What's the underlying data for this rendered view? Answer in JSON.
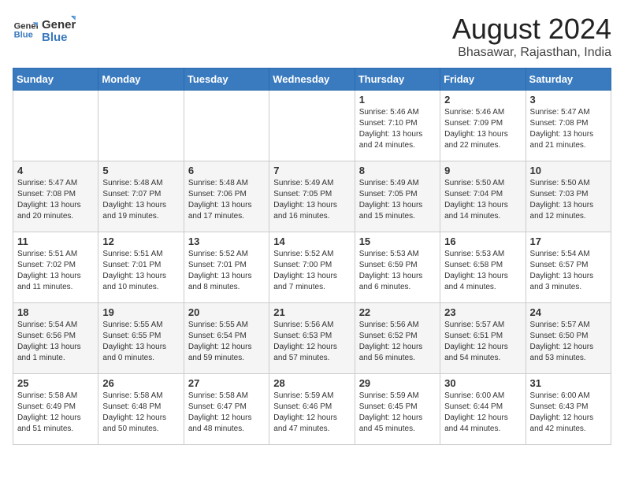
{
  "logo": {
    "line1": "General",
    "line2": "Blue"
  },
  "title": "August 2024",
  "location": "Bhasawar, Rajasthan, India",
  "days_of_week": [
    "Sunday",
    "Monday",
    "Tuesday",
    "Wednesday",
    "Thursday",
    "Friday",
    "Saturday"
  ],
  "weeks": [
    [
      {
        "day": "",
        "info": ""
      },
      {
        "day": "",
        "info": ""
      },
      {
        "day": "",
        "info": ""
      },
      {
        "day": "",
        "info": ""
      },
      {
        "day": "1",
        "info": "Sunrise: 5:46 AM\nSunset: 7:10 PM\nDaylight: 13 hours\nand 24 minutes."
      },
      {
        "day": "2",
        "info": "Sunrise: 5:46 AM\nSunset: 7:09 PM\nDaylight: 13 hours\nand 22 minutes."
      },
      {
        "day": "3",
        "info": "Sunrise: 5:47 AM\nSunset: 7:08 PM\nDaylight: 13 hours\nand 21 minutes."
      }
    ],
    [
      {
        "day": "4",
        "info": "Sunrise: 5:47 AM\nSunset: 7:08 PM\nDaylight: 13 hours\nand 20 minutes."
      },
      {
        "day": "5",
        "info": "Sunrise: 5:48 AM\nSunset: 7:07 PM\nDaylight: 13 hours\nand 19 minutes."
      },
      {
        "day": "6",
        "info": "Sunrise: 5:48 AM\nSunset: 7:06 PM\nDaylight: 13 hours\nand 17 minutes."
      },
      {
        "day": "7",
        "info": "Sunrise: 5:49 AM\nSunset: 7:05 PM\nDaylight: 13 hours\nand 16 minutes."
      },
      {
        "day": "8",
        "info": "Sunrise: 5:49 AM\nSunset: 7:05 PM\nDaylight: 13 hours\nand 15 minutes."
      },
      {
        "day": "9",
        "info": "Sunrise: 5:50 AM\nSunset: 7:04 PM\nDaylight: 13 hours\nand 14 minutes."
      },
      {
        "day": "10",
        "info": "Sunrise: 5:50 AM\nSunset: 7:03 PM\nDaylight: 13 hours\nand 12 minutes."
      }
    ],
    [
      {
        "day": "11",
        "info": "Sunrise: 5:51 AM\nSunset: 7:02 PM\nDaylight: 13 hours\nand 11 minutes."
      },
      {
        "day": "12",
        "info": "Sunrise: 5:51 AM\nSunset: 7:01 PM\nDaylight: 13 hours\nand 10 minutes."
      },
      {
        "day": "13",
        "info": "Sunrise: 5:52 AM\nSunset: 7:01 PM\nDaylight: 13 hours\nand 8 minutes."
      },
      {
        "day": "14",
        "info": "Sunrise: 5:52 AM\nSunset: 7:00 PM\nDaylight: 13 hours\nand 7 minutes."
      },
      {
        "day": "15",
        "info": "Sunrise: 5:53 AM\nSunset: 6:59 PM\nDaylight: 13 hours\nand 6 minutes."
      },
      {
        "day": "16",
        "info": "Sunrise: 5:53 AM\nSunset: 6:58 PM\nDaylight: 13 hours\nand 4 minutes."
      },
      {
        "day": "17",
        "info": "Sunrise: 5:54 AM\nSunset: 6:57 PM\nDaylight: 13 hours\nand 3 minutes."
      }
    ],
    [
      {
        "day": "18",
        "info": "Sunrise: 5:54 AM\nSunset: 6:56 PM\nDaylight: 13 hours\nand 1 minute."
      },
      {
        "day": "19",
        "info": "Sunrise: 5:55 AM\nSunset: 6:55 PM\nDaylight: 13 hours\nand 0 minutes."
      },
      {
        "day": "20",
        "info": "Sunrise: 5:55 AM\nSunset: 6:54 PM\nDaylight: 12 hours\nand 59 minutes."
      },
      {
        "day": "21",
        "info": "Sunrise: 5:56 AM\nSunset: 6:53 PM\nDaylight: 12 hours\nand 57 minutes."
      },
      {
        "day": "22",
        "info": "Sunrise: 5:56 AM\nSunset: 6:52 PM\nDaylight: 12 hours\nand 56 minutes."
      },
      {
        "day": "23",
        "info": "Sunrise: 5:57 AM\nSunset: 6:51 PM\nDaylight: 12 hours\nand 54 minutes."
      },
      {
        "day": "24",
        "info": "Sunrise: 5:57 AM\nSunset: 6:50 PM\nDaylight: 12 hours\nand 53 minutes."
      }
    ],
    [
      {
        "day": "25",
        "info": "Sunrise: 5:58 AM\nSunset: 6:49 PM\nDaylight: 12 hours\nand 51 minutes."
      },
      {
        "day": "26",
        "info": "Sunrise: 5:58 AM\nSunset: 6:48 PM\nDaylight: 12 hours\nand 50 minutes."
      },
      {
        "day": "27",
        "info": "Sunrise: 5:58 AM\nSunset: 6:47 PM\nDaylight: 12 hours\nand 48 minutes."
      },
      {
        "day": "28",
        "info": "Sunrise: 5:59 AM\nSunset: 6:46 PM\nDaylight: 12 hours\nand 47 minutes."
      },
      {
        "day": "29",
        "info": "Sunrise: 5:59 AM\nSunset: 6:45 PM\nDaylight: 12 hours\nand 45 minutes."
      },
      {
        "day": "30",
        "info": "Sunrise: 6:00 AM\nSunset: 6:44 PM\nDaylight: 12 hours\nand 44 minutes."
      },
      {
        "day": "31",
        "info": "Sunrise: 6:00 AM\nSunset: 6:43 PM\nDaylight: 12 hours\nand 42 minutes."
      }
    ]
  ]
}
